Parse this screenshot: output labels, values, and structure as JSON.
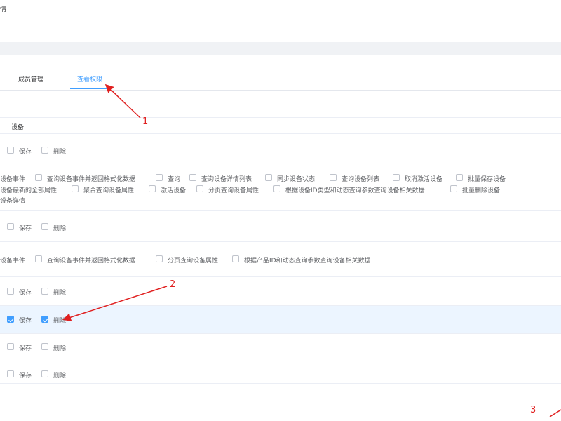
{
  "page": {
    "title_fragment": "情"
  },
  "tabs": [
    {
      "label": "成员管理",
      "active": false
    },
    {
      "label": "查看权限",
      "active": true
    }
  ],
  "table": {
    "column_header": "设备"
  },
  "rows": {
    "r1": {
      "save": "保存",
      "delete": "删除",
      "save_checked": false,
      "delete_checked": false
    },
    "r2_line1": [
      "设备事件",
      "查询设备事件并返回格式化数据",
      "查询",
      "查询设备详情列表",
      "同步设备状态",
      "查询设备列表",
      "取消激活设备",
      "批量保存设备"
    ],
    "r2_line2": [
      "设备最新的全部属性",
      "聚合查询设备属性",
      "激活设备",
      "分页查询设备属性",
      "根据设备ID类型和动态查询参数查询设备相关数据",
      "批量删除设备"
    ],
    "r2_line3": [
      "设备详情"
    ],
    "r3": {
      "save": "保存",
      "delete": "删除",
      "save_checked": false,
      "delete_checked": false
    },
    "r4_line1": [
      "设备事件",
      "查询设备事件并返回格式化数据",
      "分页查询设备属性",
      "根据产品ID和动态查询参数查询设备相关数据"
    ],
    "r5": {
      "save": "保存",
      "delete": "删除",
      "save_checked": false,
      "delete_checked": false
    },
    "r6": {
      "save": "保存",
      "delete": "删除",
      "save_checked": true,
      "delete_checked": true
    },
    "r7": {
      "save": "保存",
      "delete": "删除",
      "save_checked": false,
      "delete_checked": false
    },
    "r8": {
      "save": "保存",
      "delete": "删除",
      "save_checked": false,
      "delete_checked": false
    }
  },
  "annotations": {
    "a1": "1",
    "a2": "2",
    "a3": "3"
  },
  "colors": {
    "accent": "#409eff",
    "annotation": "#e02020",
    "highlight_row": "#ecf5ff"
  }
}
